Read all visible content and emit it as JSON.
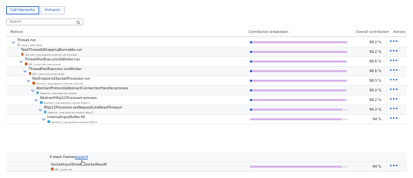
{
  "tabs": [
    "Call hierarchy",
    "Hotspots"
  ],
  "search": {
    "placeholder": "Search"
  },
  "columns": {
    "method": "Method",
    "breakdown": "Contribution breakdown",
    "overall": "Overall contribution",
    "actions": "Actions"
  },
  "colors": {
    "accent": "#2a64c6",
    "bar_fill": "#d7b4e8",
    "bar_track": "#e6e7ea",
    "bar_self": "#1f63c6",
    "tag_lang": "#d0d0d0",
    "tag_tomcat": "#d8622a",
    "tag_jre": "#d8622a",
    "tag_apache": "#44aadd"
  },
  "rows": [
    {
      "name": "Thread.run",
      "source": "Lang | java.lang",
      "pct": "99.2 %",
      "fraction": 0.992
    },
    {
      "name": "TaskThread$WrappingRunnable.run",
      "source": "Tomcat | org.apache.tomcat.util.threads",
      "pct": "99.2 %",
      "fraction": 0.992
    },
    {
      "name": "ThreadPoolExecutor$Worker.run",
      "source": "JRE | java.util.concurrent",
      "pct": "98.6 %",
      "fraction": 0.986
    },
    {
      "name": "ThreadPoolExecutor.runWorker",
      "source": "JRE | java.util.concurrent",
      "pct": "98.6 %",
      "fraction": 0.986
    },
    {
      "name": "NioEndpoint$SocketProcessor.run",
      "source": "Tomcat | org.apache.tomcat.util.net",
      "pct": "98.3 %",
      "fraction": 0.983
    },
    {
      "name": "AbstractProtocol$AbstractConnectionHandler.process",
      "source": "Apache | org.apache.coyote",
      "pct": "98.2 %",
      "fraction": 0.982
    },
    {
      "name": "AbstractHttp11Processor.process",
      "source": "Apache | org.apache.coyote.http11",
      "pct": "98.2 %",
      "fraction": 0.982
    },
    {
      "name": "Http11Processor.setRequestLineReadTimeout",
      "source": "Apache | org.apache.coyote.http11",
      "pct": "94.2 %",
      "fraction": 0.942
    },
    {
      "name": "InternalInputBuffer.fill",
      "source": "Apache | org.apache.coyote.http11",
      "pct": "94 %",
      "fraction": 0.94
    },
    {
      "name": "SocketInputStream.socketRead0",
      "source": "JRE | java.net",
      "pct": "94 %",
      "fraction": 0.94
    }
  ],
  "collapsed_frames": {
    "label": "4 stack frames",
    "link": "expand"
  }
}
